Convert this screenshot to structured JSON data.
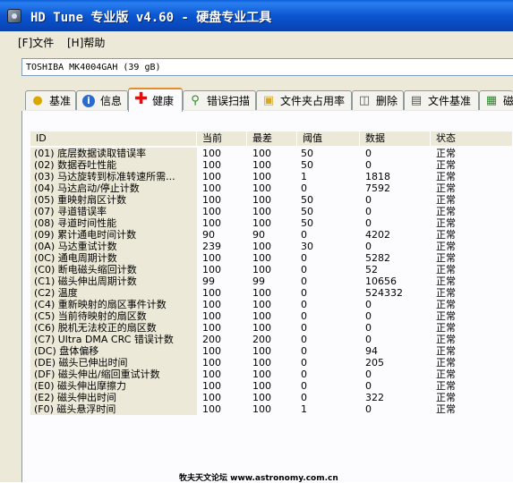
{
  "window": {
    "title": "HD Tune 专业版 v4.60 - 硬盘专业工具"
  },
  "menu": {
    "file": "[F]文件",
    "help": "[H]帮助"
  },
  "drive": {
    "selected": "TOSHIBA MK4004GAH (39 gB)"
  },
  "tabs": [
    {
      "label": "基准",
      "icon": "lightbulb-icon"
    },
    {
      "label": "信息",
      "icon": "info-icon"
    },
    {
      "label": "健康",
      "icon": "health-cross-icon"
    },
    {
      "label": "错误扫描",
      "icon": "magnifier-icon"
    },
    {
      "label": "文件夹占用率",
      "icon": "folder-icon"
    },
    {
      "label": "删除",
      "icon": "trash-icon"
    },
    {
      "label": "文件基准",
      "icon": "file-benchmark-icon"
    },
    {
      "label": "磁",
      "icon": "disk-monitor-icon"
    }
  ],
  "table": {
    "columns": [
      "ID",
      "当前",
      "最差",
      "阈值",
      "数据",
      "状态"
    ],
    "rows": [
      [
        "(01) 底层数据读取错误率",
        "100",
        "100",
        "50",
        "0",
        "正常"
      ],
      [
        "(02) 数据吞吐性能",
        "100",
        "100",
        "50",
        "0",
        "正常"
      ],
      [
        "(03) 马达旋转到标准转速所需...",
        "100",
        "100",
        "1",
        "1818",
        "正常"
      ],
      [
        "(04) 马达启动/停止计数",
        "100",
        "100",
        "0",
        "7592",
        "正常"
      ],
      [
        "(05) 重映射扇区计数",
        "100",
        "100",
        "50",
        "0",
        "正常"
      ],
      [
        "(07) 寻道错误率",
        "100",
        "100",
        "50",
        "0",
        "正常"
      ],
      [
        "(08) 寻道时间性能",
        "100",
        "100",
        "50",
        "0",
        "正常"
      ],
      [
        "(09) 累计通电时间计数",
        "90",
        "90",
        "0",
        "4202",
        "正常"
      ],
      [
        "(0A) 马达重试计数",
        "239",
        "100",
        "30",
        "0",
        "正常"
      ],
      [
        "(0C) 通电周期计数",
        "100",
        "100",
        "0",
        "5282",
        "正常"
      ],
      [
        "(C0) 断电磁头缩回计数",
        "100",
        "100",
        "0",
        "52",
        "正常"
      ],
      [
        "(C1) 磁头伸出周期计数",
        "99",
        "99",
        "0",
        "10656",
        "正常"
      ],
      [
        "(C2) 温度",
        "100",
        "100",
        "0",
        "524332",
        "正常"
      ],
      [
        "(C4) 重新映射的扇区事件计数",
        "100",
        "100",
        "0",
        "0",
        "正常"
      ],
      [
        "(C5) 当前待映射的扇区数",
        "100",
        "100",
        "0",
        "0",
        "正常"
      ],
      [
        "(C6) 脱机无法校正的扇区数",
        "100",
        "100",
        "0",
        "0",
        "正常"
      ],
      [
        "(C7) Ultra DMA CRC 错误计数",
        "200",
        "200",
        "0",
        "0",
        "正常"
      ],
      [
        "(DC) 盘体偏移",
        "100",
        "100",
        "0",
        "94",
        "正常"
      ],
      [
        "(DE) 磁头已伸出时间",
        "100",
        "100",
        "0",
        "205",
        "正常"
      ],
      [
        "(DF) 磁头伸出/缩回重试计数",
        "100",
        "100",
        "0",
        "0",
        "正常"
      ],
      [
        "(E0) 磁头伸出摩擦力",
        "100",
        "100",
        "0",
        "0",
        "正常"
      ],
      [
        "(E2) 磁头伸出时间",
        "100",
        "100",
        "0",
        "322",
        "正常"
      ],
      [
        "(F0) 磁头悬浮时间",
        "100",
        "100",
        "1",
        "0",
        "正常"
      ]
    ]
  },
  "watermark": "牧夫天文论坛 www.astronomy.com.cn"
}
